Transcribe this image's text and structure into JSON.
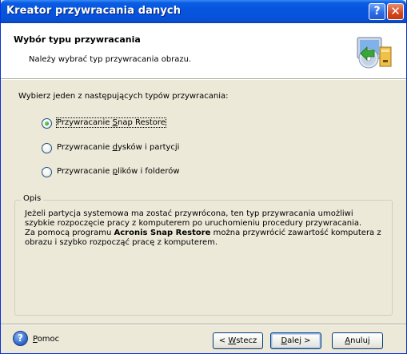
{
  "window": {
    "title": "Kreator przywracania danych",
    "help_glyph": "?",
    "close_glyph": "✕"
  },
  "header": {
    "title": "Wybór typu przywracania",
    "subtitle": "Należy wybrać typ przywracania obrazu.",
    "icon": "restore-wizard-icon"
  },
  "main": {
    "prompt": "Wybierz jeden z następujących typów przywracania:",
    "options": [
      {
        "label_pre": "Przywracanie ",
        "label_u": "S",
        "label_post": "nap Restore",
        "selected": true
      },
      {
        "label_pre": "Przywracanie ",
        "label_u": "d",
        "label_post": "ysków i partycji",
        "selected": false
      },
      {
        "label_pre": "Przywracanie ",
        "label_u": "p",
        "label_post": "lików i folderów",
        "selected": false
      }
    ]
  },
  "description": {
    "title": "Opis",
    "para1": "Jeżeli partycja systemowa ma zostać przywrócona, ten typ przywracania umożliwi szybkie rozpoczęcie pracy z komputerem po uruchomieniu procedury przywracania.",
    "para2_pre": "Za pomocą programu ",
    "para2_bold": "Acronis Snap Restore",
    "para2_post": " można przywrócić zawartość komputera z obrazu i szybko rozpocząć pracę z komputerem."
  },
  "footer": {
    "help_glyph": "?",
    "help_u": "P",
    "help_rest": "omoc",
    "back_pre": "< ",
    "back_u": "W",
    "back_post": "stecz",
    "next_u": "D",
    "next_post": "alej >",
    "cancel_u": "A",
    "cancel_post": "nuluj"
  },
  "colors": {
    "titlebar": "#0754df",
    "window_bg": "#ece9d8",
    "radio_dot": "#21a121"
  }
}
